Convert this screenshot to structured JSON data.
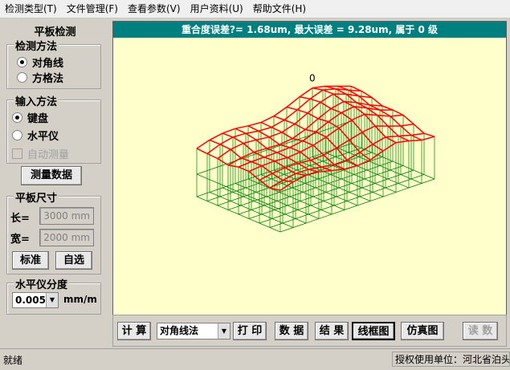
{
  "menu": [
    "检测类型(T)",
    "文件管理(F)",
    "查看参数(V)",
    "用户资料(U)",
    "帮助文件(H)"
  ],
  "panel": {
    "title": "平板检测",
    "method_group": "检测方法",
    "method_options": [
      "对角线",
      "方格法"
    ],
    "input_group": "输入方法",
    "input_options": [
      "键盘",
      "水平仪"
    ],
    "auto_measure": "自动测量",
    "measure_button": "测量数据",
    "size_group": "平板尺寸",
    "length_label": "长=",
    "length_value": "3000 mm",
    "width_label": "宽=",
    "width_value": "2000 mm",
    "standard_button": "标准",
    "custom_button": "自选",
    "level_group": "水平仪分度",
    "level_value": "0.005",
    "level_unit": "mm/m"
  },
  "header": "重合度误差?= 1.68um, 最大误差 = 9.28um, 属于 0 级",
  "plot": {
    "origin_label": "0",
    "grid_color": "#008000",
    "surface_color": "#ff0000",
    "background": "#ffffcc"
  },
  "toolbar": {
    "calc": "计 算",
    "method_select": "对角线法",
    "print": "打 印",
    "data": "数 据",
    "result": "结 果",
    "wireframe": "线框图",
    "simulation": "仿真图",
    "read": "读 数"
  },
  "status": {
    "left": "就绪",
    "right": "授权使用单位：河北省泊头"
  }
}
